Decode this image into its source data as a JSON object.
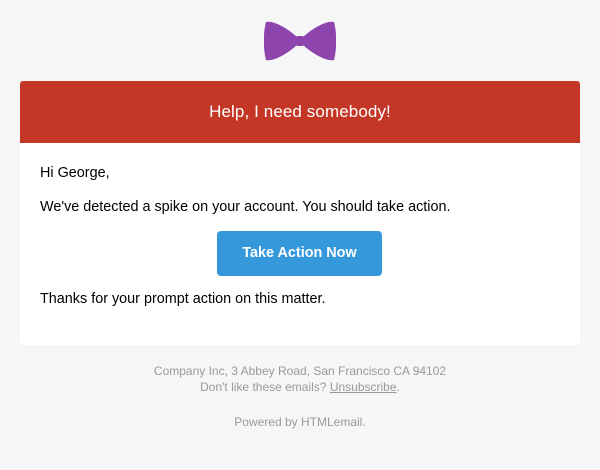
{
  "colors": {
    "page_background": "#f6f6f6",
    "alert_red": "#c43625",
    "button_blue": "#3498db",
    "logo_purple": "#8e44ad",
    "footer_text": "#999999"
  },
  "logo": {
    "icon": "bowtie-icon"
  },
  "alert": {
    "title": "Help, I need somebody!"
  },
  "body": {
    "greeting": "Hi George,",
    "message": "We've detected a spike on your account. You should take action.",
    "cta_label": "Take Action Now",
    "closing": "Thanks for your prompt action on this matter."
  },
  "footer": {
    "address": "Company Inc, 3 Abbey Road, San Francisco CA 94102",
    "unsubscribe_prefix": "Don't like these emails? ",
    "unsubscribe_link": "Unsubscribe",
    "unsubscribe_suffix": ".",
    "powered_by": "Powered by HTMLemail."
  }
}
